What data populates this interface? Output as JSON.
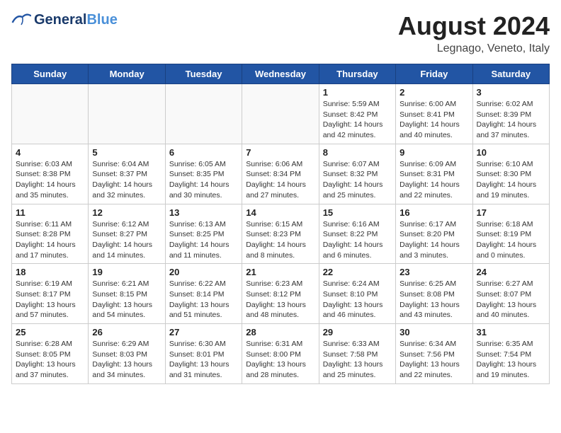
{
  "header": {
    "logo_line1": "General",
    "logo_line2": "Blue",
    "title": "August 2024",
    "subtitle": "Legnago, Veneto, Italy"
  },
  "days_of_week": [
    "Sunday",
    "Monday",
    "Tuesday",
    "Wednesday",
    "Thursday",
    "Friday",
    "Saturday"
  ],
  "weeks": [
    [
      {
        "day": "",
        "info": ""
      },
      {
        "day": "",
        "info": ""
      },
      {
        "day": "",
        "info": ""
      },
      {
        "day": "",
        "info": ""
      },
      {
        "day": "1",
        "info": "Sunrise: 5:59 AM\nSunset: 8:42 PM\nDaylight: 14 hours\nand 42 minutes."
      },
      {
        "day": "2",
        "info": "Sunrise: 6:00 AM\nSunset: 8:41 PM\nDaylight: 14 hours\nand 40 minutes."
      },
      {
        "day": "3",
        "info": "Sunrise: 6:02 AM\nSunset: 8:39 PM\nDaylight: 14 hours\nand 37 minutes."
      }
    ],
    [
      {
        "day": "4",
        "info": "Sunrise: 6:03 AM\nSunset: 8:38 PM\nDaylight: 14 hours\nand 35 minutes."
      },
      {
        "day": "5",
        "info": "Sunrise: 6:04 AM\nSunset: 8:37 PM\nDaylight: 14 hours\nand 32 minutes."
      },
      {
        "day": "6",
        "info": "Sunrise: 6:05 AM\nSunset: 8:35 PM\nDaylight: 14 hours\nand 30 minutes."
      },
      {
        "day": "7",
        "info": "Sunrise: 6:06 AM\nSunset: 8:34 PM\nDaylight: 14 hours\nand 27 minutes."
      },
      {
        "day": "8",
        "info": "Sunrise: 6:07 AM\nSunset: 8:32 PM\nDaylight: 14 hours\nand 25 minutes."
      },
      {
        "day": "9",
        "info": "Sunrise: 6:09 AM\nSunset: 8:31 PM\nDaylight: 14 hours\nand 22 minutes."
      },
      {
        "day": "10",
        "info": "Sunrise: 6:10 AM\nSunset: 8:30 PM\nDaylight: 14 hours\nand 19 minutes."
      }
    ],
    [
      {
        "day": "11",
        "info": "Sunrise: 6:11 AM\nSunset: 8:28 PM\nDaylight: 14 hours\nand 17 minutes."
      },
      {
        "day": "12",
        "info": "Sunrise: 6:12 AM\nSunset: 8:27 PM\nDaylight: 14 hours\nand 14 minutes."
      },
      {
        "day": "13",
        "info": "Sunrise: 6:13 AM\nSunset: 8:25 PM\nDaylight: 14 hours\nand 11 minutes."
      },
      {
        "day": "14",
        "info": "Sunrise: 6:15 AM\nSunset: 8:23 PM\nDaylight: 14 hours\nand 8 minutes."
      },
      {
        "day": "15",
        "info": "Sunrise: 6:16 AM\nSunset: 8:22 PM\nDaylight: 14 hours\nand 6 minutes."
      },
      {
        "day": "16",
        "info": "Sunrise: 6:17 AM\nSunset: 8:20 PM\nDaylight: 14 hours\nand 3 minutes."
      },
      {
        "day": "17",
        "info": "Sunrise: 6:18 AM\nSunset: 8:19 PM\nDaylight: 14 hours\nand 0 minutes."
      }
    ],
    [
      {
        "day": "18",
        "info": "Sunrise: 6:19 AM\nSunset: 8:17 PM\nDaylight: 13 hours\nand 57 minutes."
      },
      {
        "day": "19",
        "info": "Sunrise: 6:21 AM\nSunset: 8:15 PM\nDaylight: 13 hours\nand 54 minutes."
      },
      {
        "day": "20",
        "info": "Sunrise: 6:22 AM\nSunset: 8:14 PM\nDaylight: 13 hours\nand 51 minutes."
      },
      {
        "day": "21",
        "info": "Sunrise: 6:23 AM\nSunset: 8:12 PM\nDaylight: 13 hours\nand 48 minutes."
      },
      {
        "day": "22",
        "info": "Sunrise: 6:24 AM\nSunset: 8:10 PM\nDaylight: 13 hours\nand 46 minutes."
      },
      {
        "day": "23",
        "info": "Sunrise: 6:25 AM\nSunset: 8:08 PM\nDaylight: 13 hours\nand 43 minutes."
      },
      {
        "day": "24",
        "info": "Sunrise: 6:27 AM\nSunset: 8:07 PM\nDaylight: 13 hours\nand 40 minutes."
      }
    ],
    [
      {
        "day": "25",
        "info": "Sunrise: 6:28 AM\nSunset: 8:05 PM\nDaylight: 13 hours\nand 37 minutes."
      },
      {
        "day": "26",
        "info": "Sunrise: 6:29 AM\nSunset: 8:03 PM\nDaylight: 13 hours\nand 34 minutes."
      },
      {
        "day": "27",
        "info": "Sunrise: 6:30 AM\nSunset: 8:01 PM\nDaylight: 13 hours\nand 31 minutes."
      },
      {
        "day": "28",
        "info": "Sunrise: 6:31 AM\nSunset: 8:00 PM\nDaylight: 13 hours\nand 28 minutes."
      },
      {
        "day": "29",
        "info": "Sunrise: 6:33 AM\nSunset: 7:58 PM\nDaylight: 13 hours\nand 25 minutes."
      },
      {
        "day": "30",
        "info": "Sunrise: 6:34 AM\nSunset: 7:56 PM\nDaylight: 13 hours\nand 22 minutes."
      },
      {
        "day": "31",
        "info": "Sunrise: 6:35 AM\nSunset: 7:54 PM\nDaylight: 13 hours\nand 19 minutes."
      }
    ]
  ]
}
